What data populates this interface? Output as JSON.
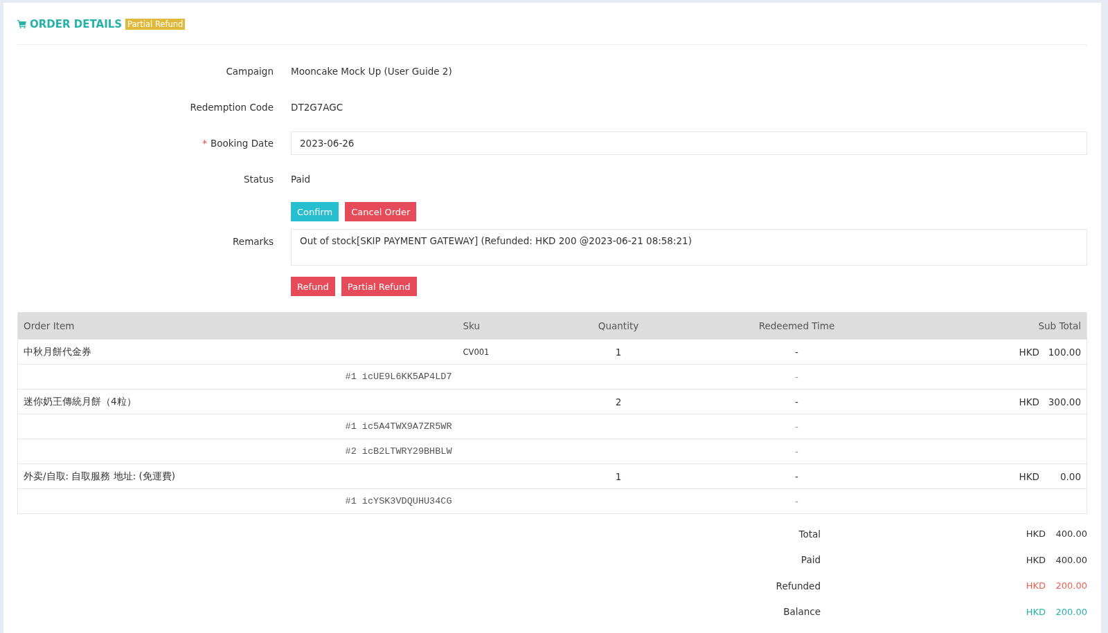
{
  "header": {
    "title": "ORDER DETAILS",
    "badge": "Partial Refund"
  },
  "fields": [
    {
      "kind": "text",
      "label": "Campaign",
      "value": "Mooncake Mock Up (User Guide 2)"
    },
    {
      "kind": "text",
      "label": "Redemption Code",
      "value": "DT2G7AGC"
    },
    {
      "kind": "input",
      "label": "Booking Date",
      "marker": "*",
      "value": "2023-06-26"
    },
    {
      "kind": "text",
      "label": "Status",
      "value": "Paid"
    },
    {
      "kind": "buttons",
      "buttons": [
        {
          "label": "Confirm",
          "kind": "confirm"
        },
        {
          "label": "Cancel Order",
          "kind": "danger"
        }
      ]
    },
    {
      "kind": "textarea",
      "label": "Remarks",
      "value": "Out of stock[SKIP PAYMENT GATEWAY] (Refunded: HKD 200 @2023-06-21 08:58:21)"
    },
    {
      "kind": "buttons",
      "buttons": [
        {
          "label": "Refund",
          "kind": "danger"
        },
        {
          "label": "Partial Refund",
          "kind": "danger"
        }
      ]
    }
  ],
  "table": {
    "columns": [
      "Order Item",
      "Sku",
      "Quantity",
      "Redeemed Time",
      "Sub Total"
    ],
    "rows": [
      {
        "kind": "item",
        "name": "中秋月餅代金券",
        "sku": "CV001",
        "quantity": "1",
        "redeemed": "-",
        "currency": "HKD",
        "amount": "100.00"
      },
      {
        "kind": "code",
        "code": "#1  icUE9L6KK5AP4LD7",
        "redeemed": "-"
      },
      {
        "kind": "item",
        "name": "迷你奶王傳統月餅（4粒）",
        "quantity": "2",
        "redeemed": "-",
        "currency": "HKD",
        "amount": "300.00"
      },
      {
        "kind": "code",
        "code": "#1  ic5A4TWX9A7ZR5WR",
        "redeemed": "-"
      },
      {
        "kind": "code",
        "code": "#2  icB2LTWRY29BHBLW",
        "redeemed": "-"
      },
      {
        "kind": "item",
        "name": "外卖/自取: 自取服務 地址: (免運費)",
        "quantity": "1",
        "redeemed": "-",
        "currency": "HKD",
        "amount": "0.00"
      },
      {
        "kind": "code",
        "code": "#1  icYSK3VDQUHU34CG",
        "redeemed": "-"
      }
    ]
  },
  "summary": [
    {
      "label": "Total",
      "currency": "HKD",
      "amount": "400.00",
      "color": "#333333"
    },
    {
      "label": "Paid",
      "currency": "HKD",
      "amount": "400.00",
      "color": "#333333"
    },
    {
      "label": "Refunded",
      "currency": "HKD",
      "amount": "200.00",
      "color": "#f0604d"
    },
    {
      "label": "Balance",
      "currency": "HKD",
      "amount": "200.00",
      "color": "#27b2a8"
    }
  ]
}
